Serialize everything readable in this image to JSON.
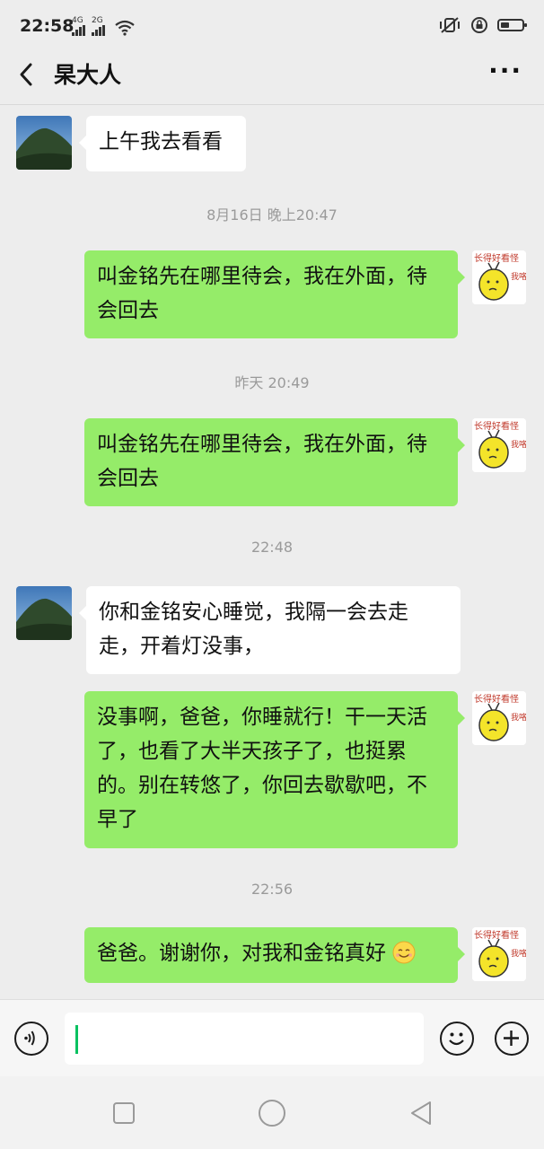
{
  "status_bar": {
    "time": "22:58",
    "network_1": "4G",
    "network_2": "2G",
    "battery_level": 0.4
  },
  "header": {
    "title": "杲大人",
    "more_label": "···"
  },
  "messages": [
    {
      "side": "left",
      "text": "上午我去看看"
    },
    {
      "type": "timestamp",
      "text": "8月16日 晚上20:47"
    },
    {
      "side": "right",
      "text": "叫金铭先在哪里待会，我在外面，待会回去"
    },
    {
      "type": "timestamp",
      "text": "昨天 20:49"
    },
    {
      "side": "right",
      "text": "叫金铭先在哪里待会，我在外面，待会回去"
    },
    {
      "type": "timestamp",
      "text": "22:48"
    },
    {
      "side": "left",
      "text": "你和金铭安心睡觉，我隔一会去走走，开着灯没事，"
    },
    {
      "side": "right",
      "text": "没事啊，爸爸，你睡就行！干一天活了，也看了大半天孩子了，也挺累的。别在转悠了，你回去歇歇吧，不早了"
    },
    {
      "type": "timestamp",
      "text": "22:56"
    },
    {
      "side": "right",
      "text": "爸爸。谢谢你，对我和金铭真好",
      "emoji": "smile-emoji"
    }
  ],
  "sticker_avatar": {
    "text_top": "长得好看怪",
    "text_side": "我咯?"
  },
  "input": {
    "value": "",
    "voice_icon": "voice-icon",
    "emoji_icon": "emoji-icon",
    "plus_icon": "plus-icon"
  },
  "navigation": {
    "square_icon": "recent-apps-icon",
    "circle_icon": "home-icon",
    "triangle_icon": "back-nav-icon"
  },
  "colors": {
    "green_bubble": "#95ec69",
    "white_bubble": "#ffffff",
    "background": "#ededed",
    "caret": "#07c160"
  }
}
